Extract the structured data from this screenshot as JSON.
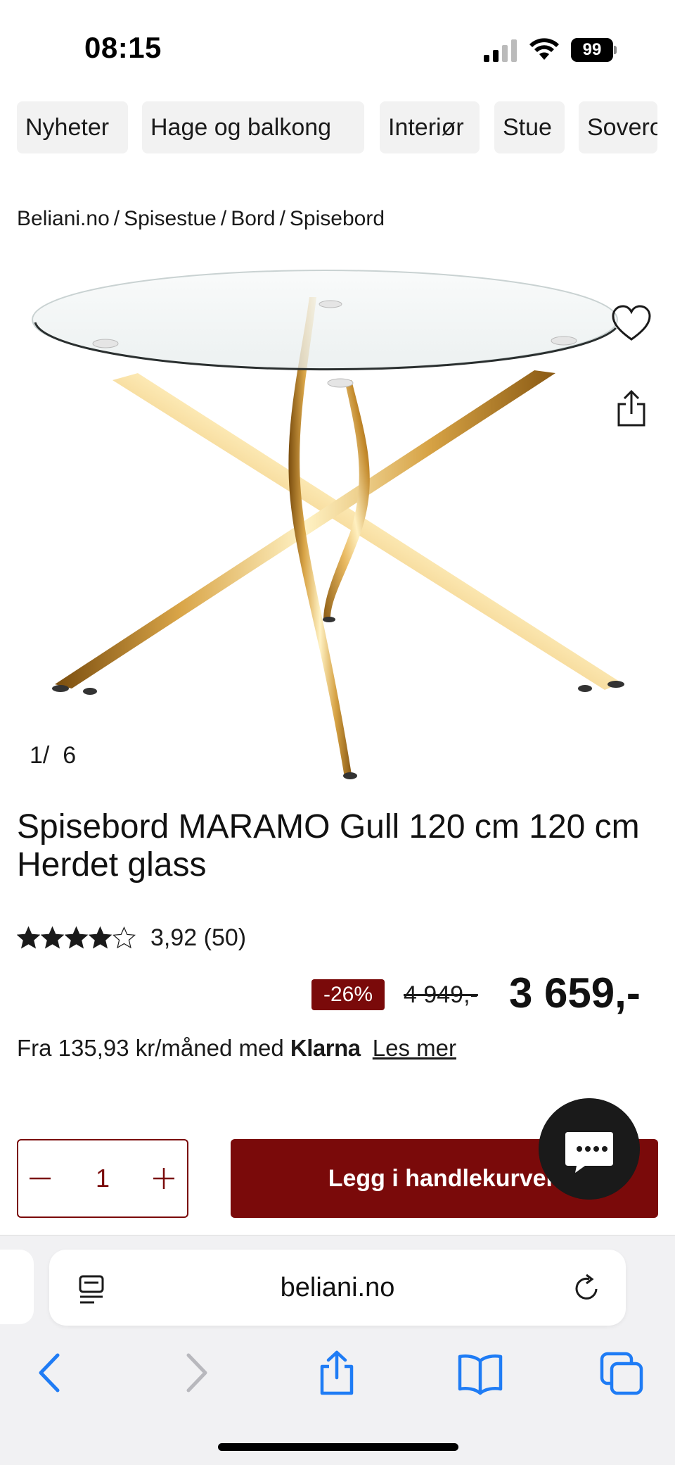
{
  "status": {
    "time": "08:15",
    "battery": "99"
  },
  "categories": [
    "Nyheter",
    "Hage og balkong",
    "Interiør",
    "Stue",
    "Soverom"
  ],
  "breadcrumb": [
    "Beliani.no",
    "Spisestue",
    "Bord",
    "Spisebord"
  ],
  "gallery": {
    "current": "1",
    "separator": "/",
    "total": "6"
  },
  "product": {
    "title": "Spisebord MARAMO Gull 120 cm 120 cm Herdet glass",
    "rating_text": "3,92 (50)",
    "rating_value": 3.92,
    "rating_max": 5,
    "discount": "-26%",
    "old_price": "4 949,-",
    "price": "3 659,-"
  },
  "klarna": {
    "prefix": "Fra 135,93 kr/måned med",
    "brand": "Klarna",
    "link": "Les mer"
  },
  "cart": {
    "quantity": "1",
    "button": "Legg i handlekurven"
  },
  "browser": {
    "url": "beliani.no"
  },
  "colors": {
    "accent": "#7a0a0a",
    "chip_bg": "#f2f2f2",
    "browser_blue": "#1f7cf5"
  },
  "icons": [
    "heart-icon",
    "share-icon",
    "chat-icon",
    "reader-icon",
    "reload-icon",
    "back-icon",
    "forward-icon",
    "bookmarks-icon",
    "tabs-icon"
  ]
}
